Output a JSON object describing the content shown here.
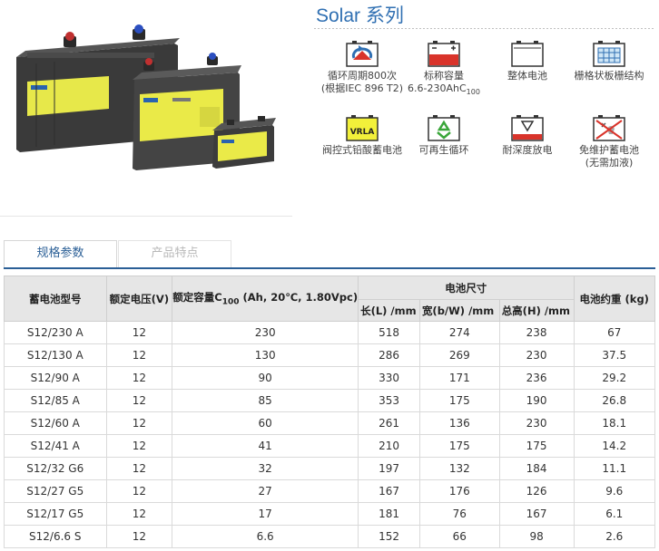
{
  "series": {
    "title": "Solar 系列"
  },
  "features": [
    {
      "icon": "cycle-life-icon",
      "lines": [
        "循环周期800次",
        "(根据IEC 896 T2)"
      ]
    },
    {
      "icon": "capacity-icon",
      "lines": [
        "标称容量",
        "6.6-230AhC"
      ],
      "sub": "100"
    },
    {
      "icon": "monoblock-icon",
      "lines": [
        "整体电池"
      ]
    },
    {
      "icon": "grid-plate-icon",
      "lines": [
        "栅格状板栅结构"
      ]
    },
    {
      "icon": "vrla-icon",
      "icon_text": "VRLA",
      "lines": [
        "阀控式铅酸蓄电池"
      ]
    },
    {
      "icon": "recycle-icon",
      "lines": [
        "可再生循环"
      ]
    },
    {
      "icon": "deep-discharge-icon",
      "lines": [
        "耐深度放电"
      ]
    },
    {
      "icon": "maintenance-free-icon",
      "lines": [
        "免维护蓄电池",
        "(无需加液)"
      ]
    }
  ],
  "tabs": [
    {
      "label": "规格参数",
      "active": true
    },
    {
      "label": "产品特点",
      "active": false
    }
  ],
  "table": {
    "headers": {
      "model": "蓄电池型号",
      "voltage": "额定电压(V)",
      "capacity_prefix": "额定容量C",
      "capacity_sub": "100",
      "capacity_suffix": " (Ah, 20℃, 1.80Vpc)",
      "dimensions": "电池尺寸",
      "length": "长(L) /mm",
      "width": "宽(b/W) /mm",
      "height": "总高(H) /mm",
      "weight": "电池约重  (kg)"
    },
    "rows": [
      [
        "S12/230 A",
        "12",
        "230",
        "518",
        "274",
        "238",
        "67"
      ],
      [
        "S12/130 A",
        "12",
        "130",
        "286",
        "269",
        "230",
        "37.5"
      ],
      [
        "S12/90 A",
        "12",
        "90",
        "330",
        "171",
        "236",
        "29.2"
      ],
      [
        "S12/85 A",
        "12",
        "85",
        "353",
        "175",
        "190",
        "26.8"
      ],
      [
        "S12/60 A",
        "12",
        "60",
        "261",
        "136",
        "230",
        "18.1"
      ],
      [
        "S12/41 A",
        "12",
        "41",
        "210",
        "175",
        "175",
        "14.2"
      ],
      [
        "S12/32 G6",
        "12",
        "32",
        "197",
        "132",
        "184",
        "11.1"
      ],
      [
        "S12/27 G5",
        "12",
        "27",
        "167",
        "176",
        "126",
        "9.6"
      ],
      [
        "S12/17 G5",
        "12",
        "17",
        "181",
        "76",
        "167",
        "6.1"
      ],
      [
        "S12/6.6 S",
        "12",
        "6.6",
        "152",
        "66",
        "98",
        "2.6"
      ]
    ]
  },
  "colors": {
    "accent": "#2f6fb2",
    "tab_border": "#2b5f96",
    "battery_body": "#3a3a3a",
    "label_yellow": "#f2f03a"
  }
}
